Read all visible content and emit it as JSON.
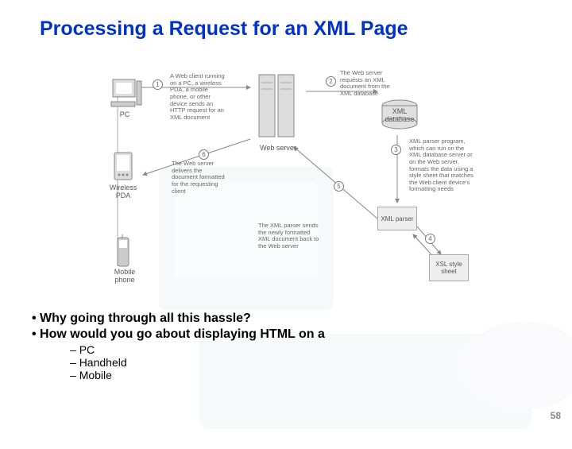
{
  "title": "Processing a Request for an XML Page",
  "diagram": {
    "nodes": {
      "pc": "PC",
      "pda": "Wireless PDA",
      "phone": "Mobile phone",
      "webserver": "Web server",
      "xmldb": "XML database",
      "xmlparser": "XML parser",
      "xsl": "XSL style sheet"
    },
    "steps": {
      "s1": "1",
      "s2": "2",
      "s3": "3",
      "s4": "4",
      "s5": "5",
      "s6": "6"
    },
    "captions": {
      "c1": "A Web client running on a PC, a wireless PDA, a mobile phone, or other device sends an HTTP request for an XML document",
      "c2": "The Web server requests an XML document from the XML database",
      "c3": "XML parser program, which can run on the XML database server or on the Web server, formats the data using a style sheet that matches the Web client device's formatting needs",
      "c5": "The XML parser sends the newly formatted XML document back to the Web server",
      "c6": "The Web server delivers the document formatted for the requesting client"
    }
  },
  "bullets": {
    "q1": "Why going through all this hassle?",
    "q2": "How would you go about displaying HTML on a",
    "items": [
      "PC",
      "Handheld",
      "Mobile"
    ]
  },
  "page_number": "58"
}
